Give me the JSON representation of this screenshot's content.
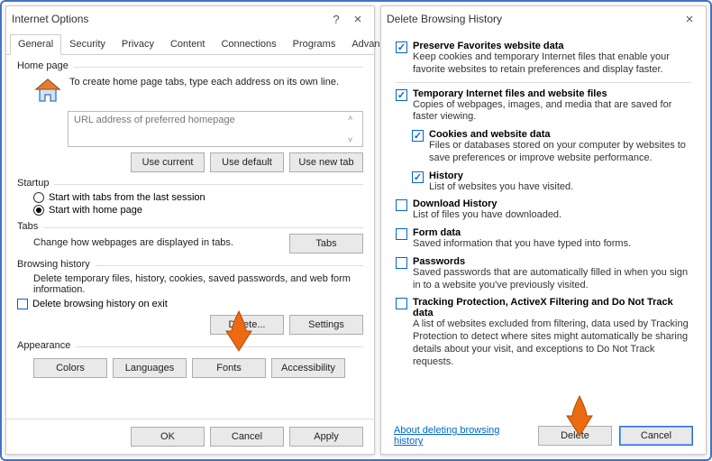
{
  "left": {
    "title": "Internet Options",
    "tabs": [
      "General",
      "Security",
      "Privacy",
      "Content",
      "Connections",
      "Programs",
      "Advanced"
    ],
    "active_tab": 0,
    "homepage": {
      "heading": "Home page",
      "instruction": "To create home page tabs, type each address on its own line.",
      "placeholder": "URL address of preferred homepage",
      "btn_current": "Use current",
      "btn_default": "Use default",
      "btn_newtab": "Use new tab"
    },
    "startup": {
      "heading": "Startup",
      "opt_last": "Start with tabs from the last session",
      "opt_home": "Start with home page",
      "selected": "home"
    },
    "tabs_section": {
      "heading": "Tabs",
      "desc": "Change how webpages are displayed in tabs.",
      "btn": "Tabs"
    },
    "history": {
      "heading": "Browsing history",
      "desc": "Delete temporary files, history, cookies, saved passwords, and web form information.",
      "chk_label": "Delete browsing history on exit",
      "btn_delete": "Delete...",
      "btn_settings": "Settings"
    },
    "appearance": {
      "heading": "Appearance",
      "btn_colors": "Colors",
      "btn_lang": "Languages",
      "btn_fonts": "Fonts",
      "btn_access": "Accessibility"
    },
    "footer": {
      "ok": "OK",
      "cancel": "Cancel",
      "apply": "Apply"
    }
  },
  "right": {
    "title": "Delete Browsing History",
    "items": [
      {
        "checked": true,
        "title": "Preserve Favorites website data",
        "desc": "Keep cookies and temporary Internet files that enable your favorite websites to retain preferences and display faster.",
        "hr": true
      },
      {
        "checked": true,
        "title": "Temporary Internet files and website files",
        "desc": "Copies of webpages, images, and media that are saved for faster viewing."
      },
      {
        "checked": true,
        "title": "Cookies and website data",
        "desc": "Files or databases stored on your computer by websites to save preferences or improve website performance.",
        "indent": true
      },
      {
        "checked": true,
        "title": "History",
        "desc": "List of websites you have visited.",
        "indent": true
      },
      {
        "checked": false,
        "title": "Download History",
        "desc": "List of files you have downloaded."
      },
      {
        "checked": false,
        "title": "Form data",
        "desc": "Saved information that you have typed into forms."
      },
      {
        "checked": false,
        "title": "Passwords",
        "desc": "Saved passwords that are automatically filled in when you sign in to a website you've previously visited."
      },
      {
        "checked": false,
        "title": "Tracking Protection, ActiveX Filtering and Do Not Track data",
        "desc": "A list of websites excluded from filtering, data used by Tracking Protection to detect where sites might automatically be sharing details about your visit, and exceptions to Do Not Track requests."
      }
    ],
    "link": "About deleting browsing history",
    "btn_delete": "Delete",
    "btn_cancel": "Cancel"
  }
}
